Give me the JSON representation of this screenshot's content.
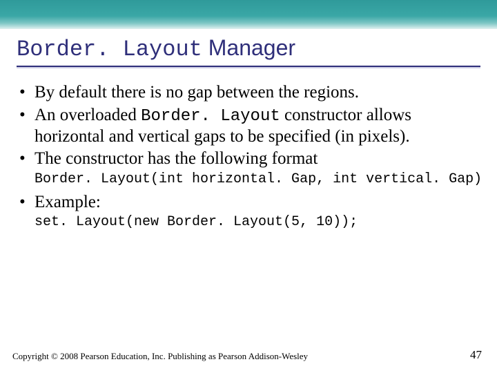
{
  "title": {
    "mono": "Border. Layout",
    "rest": " Manager"
  },
  "bullets": {
    "b1": "By default there is no gap between the regions.",
    "b2_pre": "An overloaded ",
    "b2_mono": "Border. Layout",
    "b2_post": " constructor allows horizontal and vertical gaps to be specified (in pixels).",
    "b3": "The constructor has the following format",
    "code1": "Border. Layout(int horizontal. Gap, int vertical. Gap)",
    "b4": "Example:",
    "code2": "set. Layout(new Border. Layout(5, 10));"
  },
  "footer": {
    "copyright": "Copyright © 2008 Pearson Education, Inc. Publishing as Pearson Addison-Wesley",
    "page": "47"
  }
}
